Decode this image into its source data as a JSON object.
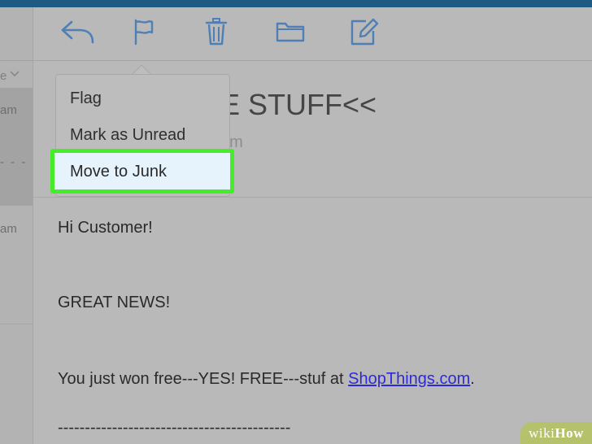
{
  "message_list": {
    "sort_label": "e",
    "items": [
      {
        "time": "am"
      },
      {
        "time": "am"
      }
    ],
    "dashes": "- - -"
  },
  "toolbar": {
    "reply_icon": "reply-icon",
    "flag_icon": "flag-icon",
    "trash_icon": "trash-icon",
    "folder_icon": "folder-icon",
    "compose_icon": "compose-icon"
  },
  "message": {
    "subject": "E STUFF<<",
    "meta": "am",
    "body": {
      "greeting": "Hi Customer!",
      "headline": "GREAT NEWS!",
      "line_prefix": "You just won free---YES! FREE---stuf at ",
      "link_text": "ShopThings.com",
      "line_suffix": ".",
      "divider": "-------------------------------------------"
    }
  },
  "flag_menu": {
    "items": [
      {
        "label": "Flag"
      },
      {
        "label": "Mark as Unread"
      },
      {
        "label": "Move to Junk"
      }
    ],
    "highlight_color": "#46ec2a"
  },
  "watermark": {
    "prefix": "wiki",
    "suffix": "How"
  },
  "colors": {
    "accent": "#4f7fb5",
    "topbar": "#1f5a82",
    "link": "#2e2ad6"
  }
}
